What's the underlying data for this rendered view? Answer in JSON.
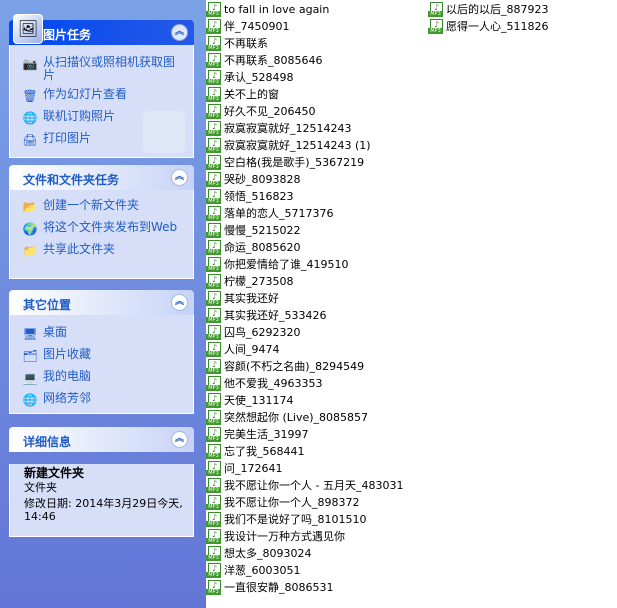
{
  "task_panel_picture": {
    "title": "图片任务",
    "items": [
      {
        "label": "从扫描仪或照相机获取图片",
        "icon": "camera-icon"
      },
      {
        "label": "作为幻灯片查看",
        "icon": "slideshow-icon"
      },
      {
        "label": "联机订购照片",
        "icon": "order-prints-icon"
      },
      {
        "label": "打印图片",
        "icon": "print-icon"
      }
    ]
  },
  "task_panel_folder": {
    "title": "文件和文件夹任务",
    "items": [
      {
        "label": "创建一个新文件夹",
        "icon": "new-folder-icon"
      },
      {
        "label": "将这个文件夹发布到Web",
        "icon": "publish-web-icon"
      },
      {
        "label": "共享此文件夹",
        "icon": "share-folder-icon"
      }
    ]
  },
  "task_panel_places": {
    "title": "其它位置",
    "items": [
      {
        "label": "桌面",
        "icon": "desktop-icon"
      },
      {
        "label": "图片收藏",
        "icon": "my-pictures-icon"
      },
      {
        "label": "我的电脑",
        "icon": "my-computer-icon"
      },
      {
        "label": "网络芳邻",
        "icon": "network-places-icon"
      }
    ]
  },
  "task_panel_details": {
    "title": "详细信息",
    "name": "新建文件夹",
    "type": "文件夹",
    "modified": "修改日期: 2014年3月29日今天, 14:46"
  },
  "files_col1": [
    "to fall in love again",
    "伴_7450901",
    "不再联系",
    "不再联系_8085646",
    "承认_528498",
    "关不上的窗",
    "好久不见_206450",
    "寂寞寂寞就好_12514243",
    "寂寞寂寞就好_12514243 (1)",
    "空白格(我是歌手)_5367219",
    "哭砂_8093828",
    "领悟_516823",
    "落单的恋人_5717376",
    "慢慢_5215022",
    "命运_8085620",
    "你把爱情给了谁_419510",
    "柠檬_273508",
    "其实我还好",
    "其实我还好_533426",
    "囚鸟_6292320",
    "人间_9474",
    "容颜(不朽之名曲)_8294549",
    "他不爱我_4963353",
    "天使_131174",
    "突然想起你 (Live)_8085857",
    "完美生活_31997",
    "忘了我_568441",
    "问_172641",
    "我不愿让你一个人 - 五月天_483031",
    "我不愿让你一个人_898372",
    "我们不是说好了吗_8101510",
    "我设计一万种方式遇见你",
    "想太多_8093024",
    "洋葱_6003051",
    "一直很安静_8086531"
  ],
  "files_col2": [
    "以后的以后_887923",
    "愿得一人心_511826"
  ],
  "file_icon_label": "MP3",
  "file_icon_name": "mp3-file-icon"
}
